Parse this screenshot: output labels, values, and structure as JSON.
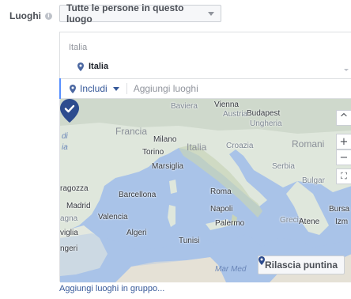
{
  "field": {
    "label": "Luoghi",
    "info_icon": "i"
  },
  "audience_select": {
    "value": "Tutte le persone in questo luogo"
  },
  "locations": {
    "country_header": "Italia",
    "selected": [
      {
        "name": "Italia"
      }
    ]
  },
  "search": {
    "include_label": "Includi",
    "placeholder": "Aggiungi luoghi"
  },
  "map": {
    "labels": {
      "baviera": "Baviera",
      "vienna": "Vienna",
      "budapest": "Budapest",
      "austria": "Austria",
      "ungheria": "Ungheria",
      "francia": "Francia",
      "milano": "Milano",
      "italia": "Italia",
      "croazia": "Croazia",
      "romania": "Romani",
      "torino": "Torino",
      "marsiglia": "Marsiglia",
      "serbia": "Serbia",
      "bulgaria": "Bulgar",
      "roma": "Roma",
      "saragozza": "ragozza",
      "barcellona": "Barcellona",
      "madrid": "Madrid",
      "valencia": "Valencia",
      "napoli": "Napoli",
      "spagna": "agna",
      "siviglia": "viglia",
      "algeri": "Algeri",
      "tunisi": "Tunisi",
      "palermo": "Palermo",
      "grecia": "Grecia",
      "atene": "Atene",
      "bursa": "Bursa",
      "izmir": "Izm",
      "tangeri": "ngeri",
      "mar_med": "Mar Med",
      "di": "di",
      "ia": "ia"
    },
    "controls": {
      "scroll_up": "^",
      "zoom_in": "+",
      "zoom_out": "−",
      "fullscreen": "⛶"
    }
  },
  "drop_pin_label": "Rilascia puntina",
  "bulk_link": "Aggiungi luoghi in gruppo..."
}
